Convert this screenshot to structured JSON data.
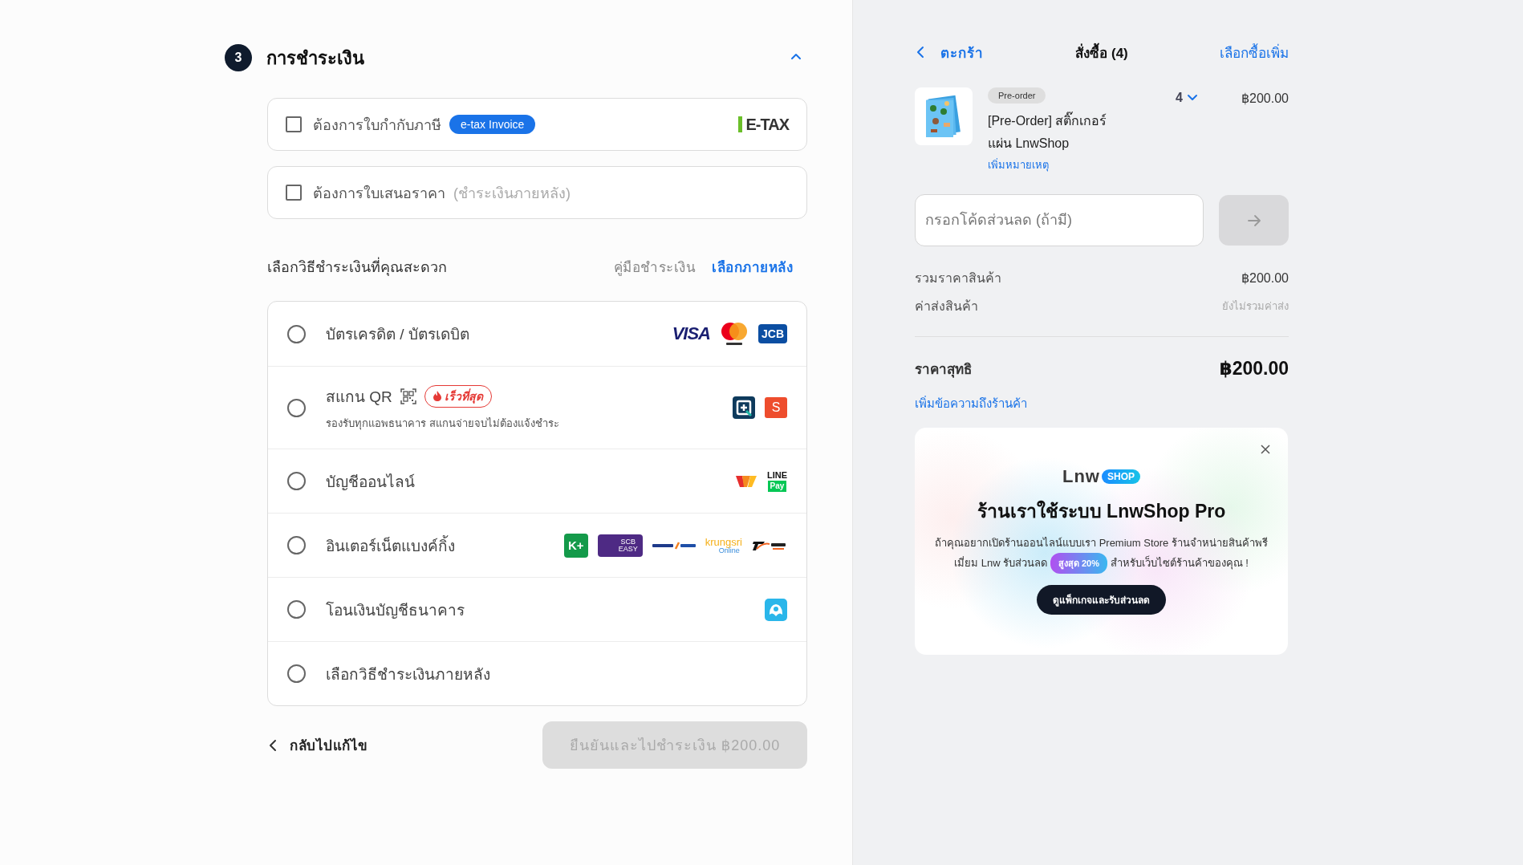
{
  "section": {
    "number": "3",
    "title": "การชำระเงิน",
    "expanded": true
  },
  "document_options": [
    {
      "label": "ต้องการใบกำกับภาษี",
      "checked": false,
      "badge": "e-tax Invoice",
      "logo": {
        "kind": "etax",
        "lines": [
          "E-TAX"
        ]
      }
    },
    {
      "label": "ต้องการใบเสนอราคา",
      "checked": false,
      "note": "(ชำระเงินภายหลัง)"
    }
  ],
  "methods_header": {
    "title": "เลือกวิธีชำระเงินที่คุณสะดวก",
    "links": [
      {
        "label": "คู่มือชำระเงิน",
        "kind": "guide"
      },
      {
        "label": "เลือกภายหลัง",
        "kind": "later"
      }
    ]
  },
  "payment_methods": [
    {
      "label": "บัตรเครดิต / บัตรเดบิต",
      "selected": false,
      "logos": [
        {
          "kind": "visa",
          "lines": [
            "VISA"
          ]
        },
        {
          "kind": "mastercard"
        },
        {
          "kind": "jcb",
          "lines": [
            "JCB"
          ]
        }
      ]
    },
    {
      "label": "สแกน QR",
      "selected": false,
      "qr": true,
      "tag": "เร็วที่สุด",
      "description": "รองรับทุกแอพธนาคาร สแกนจ่ายจบไม่ต้องแจ้งชำระ",
      "logos": [
        {
          "kind": "promptpay"
        },
        {
          "kind": "shopee",
          "lines": [
            "S"
          ]
        }
      ]
    },
    {
      "label": "บัญชีออนไลน์",
      "selected": false,
      "logos": [
        {
          "kind": "truemoney"
        },
        {
          "kind": "linepay",
          "lines": [
            "LINE",
            "Pay"
          ]
        }
      ]
    },
    {
      "label": "อินเตอร์เน็ตแบงค์กิ้ง",
      "selected": false,
      "logos": [
        {
          "kind": "kplus",
          "lines": [
            "K+"
          ]
        },
        {
          "kind": "scb",
          "lines": [
            "SCB",
            "EASY"
          ]
        },
        {
          "kind": "bualuang"
        },
        {
          "kind": "krungsri",
          "lines": [
            "krungsri",
            "Online"
          ]
        },
        {
          "kind": "ttb"
        }
      ]
    },
    {
      "label": "โอนเงินบัญชีธนาคาร",
      "selected": false,
      "logos": [
        {
          "kind": "kbank"
        }
      ]
    },
    {
      "label": "เลือกวิธีชำระเงินภายหลัง",
      "selected": false
    }
  ],
  "footer": {
    "back": "กลับไปแก้ไข",
    "confirm": {
      "label": "ยืนยันและไปชำระเงิน ฿200.00",
      "disabled": true
    }
  },
  "cart": {
    "back": "ตะกร้า",
    "title": "สั่งซื้อ (4)",
    "more": "เลือกซื้อเพิ่ม"
  },
  "item": {
    "badge": "Pre-order",
    "name": "[Pre-Order] สติ๊กเกอร์แผ่น LnwShop",
    "quantity": "4",
    "price": "฿200.00",
    "note_link": "เพิ่มหมายเหตุ"
  },
  "discount": {
    "placeholder": "กรอกโค้ดส่วนลด (ถ้ามี)",
    "disabled": true
  },
  "summary": [
    {
      "label": "รวมราคาสินค้า",
      "value": "฿200.00",
      "kind": "amount"
    },
    {
      "label": "ค่าส่งสินค้า",
      "value": "ยังไม่รวมค่าส่ง",
      "kind": "note"
    }
  ],
  "total": {
    "label": "ราคาสุทธิ",
    "value": "฿200.00"
  },
  "message_link": "เพิ่มข้อความถึงร้านค้า",
  "promo": {
    "logo": [
      "Lnw",
      "SHOP"
    ],
    "title": "ร้านเราใช้ระบบ LnwShop Pro",
    "text_before": "ถ้าคุณอยากเปิดร้านออนไลน์แบบเรา Premium Store ร้านจำหน่ายสินค้าพรีเมี่ยม Lnw รับส่วนลด",
    "pill": "สูงสุด 20%",
    "text_after": "สำหรับเว็บไซต์ร้านค้าของคุณ !",
    "button": "ดูแพ็กเกจและรับส่วนลด"
  }
}
